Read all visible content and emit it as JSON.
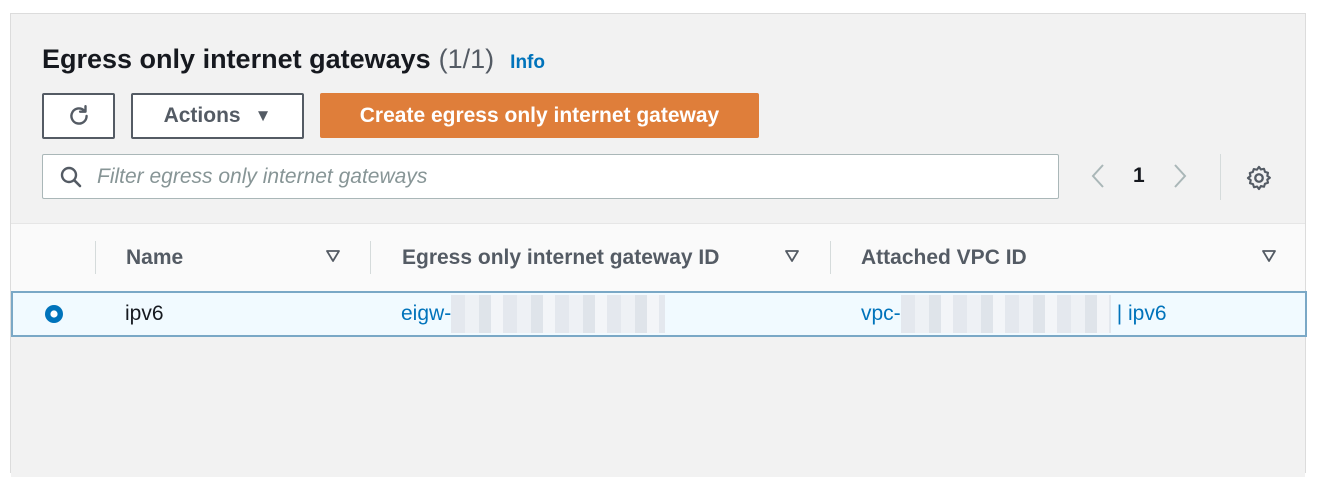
{
  "header": {
    "title": "Egress only internet gateways",
    "count": "(1/1)",
    "info_label": "Info"
  },
  "toolbar": {
    "refresh_icon": "refresh-icon",
    "actions_label": "Actions",
    "create_label": "Create egress only internet gateway"
  },
  "search": {
    "placeholder": "Filter egress only internet gateways",
    "value": ""
  },
  "pagination": {
    "current_page": "1"
  },
  "table": {
    "columns": [
      "Name",
      "Egress only internet gateway ID",
      "Attached VPC ID"
    ],
    "rows": [
      {
        "selected": true,
        "name": "ipv6",
        "gateway_id_prefix": "eigw-",
        "vpc_id_prefix": "vpc-",
        "vpc_name_suffix": "| ipv6"
      }
    ]
  },
  "colors": {
    "accent": "#df7e3a",
    "link": "#0073bb",
    "selected_row_border": "#7aa8c6",
    "selected_row_bg": "#f1faff"
  }
}
